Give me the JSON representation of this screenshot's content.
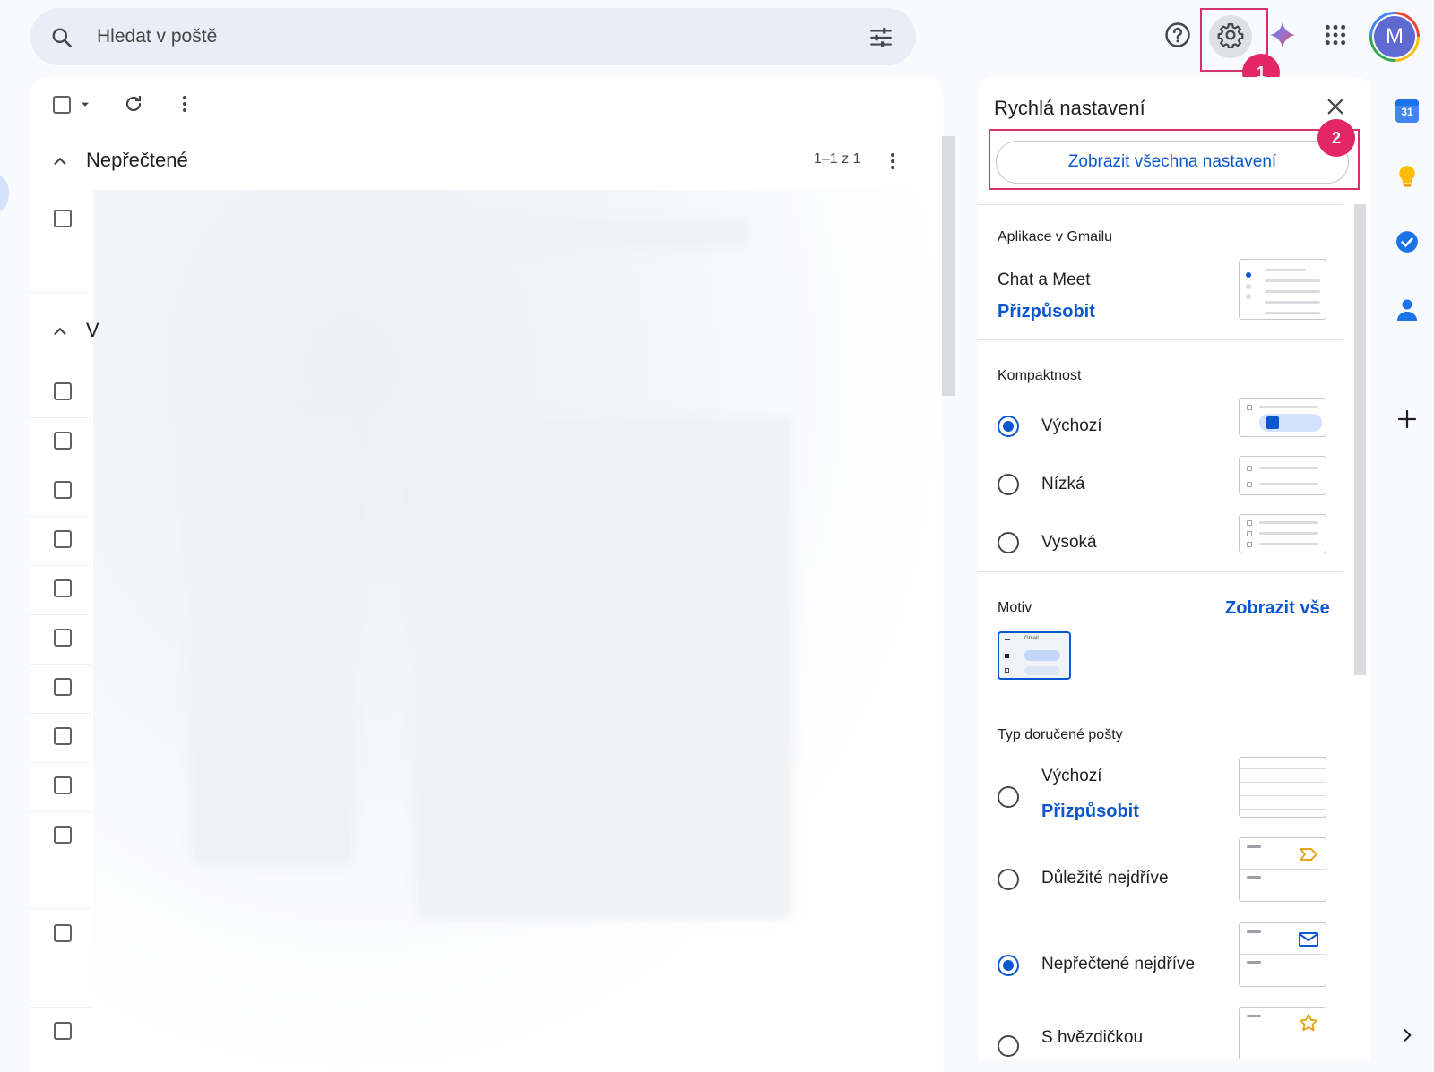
{
  "search": {
    "placeholder": "Hledat v poště"
  },
  "toolbar": {
    "select_all": "select-all",
    "refresh": "refresh",
    "more": "more"
  },
  "mail_list": {
    "section1": {
      "title": "Nepřečtené",
      "count": "1–1 z 1"
    },
    "section2": {
      "title": "V"
    }
  },
  "badges": {
    "one": "1",
    "two": "2"
  },
  "avatar": {
    "initial": "M"
  },
  "quick_settings": {
    "title": "Rychlá nastavení",
    "all_settings_button": "Zobrazit všechna nastavení",
    "apps": {
      "heading": "Aplikace v Gmailu",
      "item": "Chat a Meet",
      "customize": "Přizpůsobit"
    },
    "density": {
      "heading": "Kompaktnost",
      "options": [
        {
          "label": "Výchozí",
          "selected": true
        },
        {
          "label": "Nízká",
          "selected": false
        },
        {
          "label": "Vysoká",
          "selected": false
        }
      ]
    },
    "theme": {
      "heading": "Motiv",
      "show_all": "Zobrazit vše",
      "thumb_label": "Gmail"
    },
    "inbox_type": {
      "heading": "Typ doručené pošty",
      "options": [
        {
          "label": "Výchozí",
          "customize": "Přizpůsobit",
          "selected": false
        },
        {
          "label": "Důležité nejdříve",
          "selected": false
        },
        {
          "label": "Nepřečtené nejdříve",
          "selected": true
        },
        {
          "label": "S hvězdičkou",
          "selected": false
        }
      ]
    }
  },
  "side_panel": {
    "calendar_day": "31"
  },
  "colors": {
    "accent": "#0b57d0",
    "highlight": "#d6336c",
    "badge": "#e22666"
  }
}
